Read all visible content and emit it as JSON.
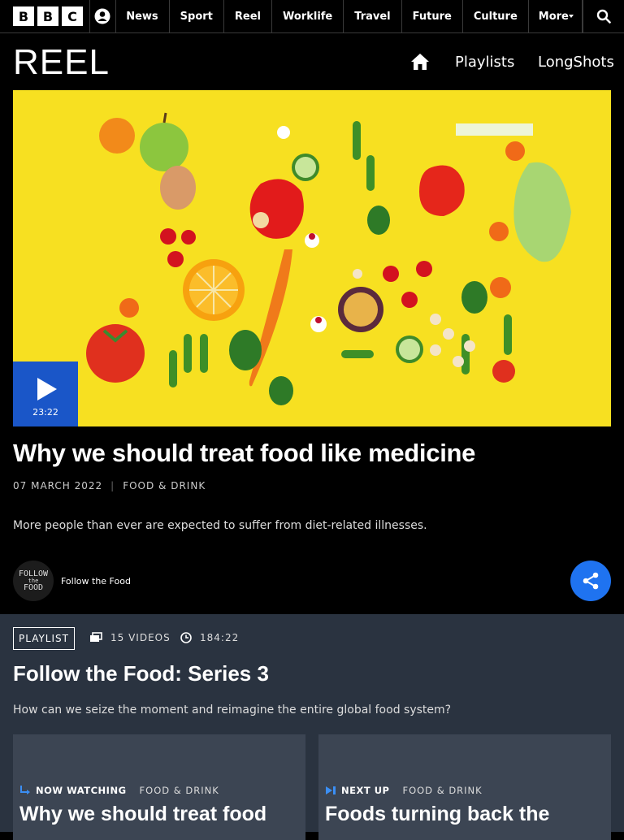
{
  "topnav": {
    "logo_letters": [
      "B",
      "B",
      "C"
    ],
    "links": [
      "News",
      "Sport",
      "Reel",
      "Worklife",
      "Travel",
      "Future",
      "Culture"
    ],
    "more_label": "More"
  },
  "reel_header": {
    "logo": "REEL",
    "links": [
      "Playlists",
      "LongShots"
    ]
  },
  "video": {
    "duration": "23:22",
    "title": "Why we should treat food like medicine",
    "date": "07 MARCH 2022",
    "separator": "|",
    "category": "FOOD & DRINK",
    "description": "More people than ever are expected to suffer from diet-related illnesses.",
    "brand_avatar_lines": [
      "FOLLOW",
      "the",
      "FOOD"
    ],
    "brand_name": "Follow the Food"
  },
  "playlist": {
    "tag": "PLAYLIST",
    "video_count": "15 VIDEOS",
    "duration": "184:22",
    "title": "Follow the Food: Series 3",
    "description": "How can we seize the moment and reimagine the entire global food system?",
    "cards": [
      {
        "kind": "NOW WATCHING",
        "category": "FOOD & DRINK",
        "title": "Why we should treat food"
      },
      {
        "kind": "NEXT UP",
        "category": "FOOD & DRINK",
        "title": "Foods turning back the"
      }
    ]
  },
  "colors": {
    "accent_blue": "#1f73f0",
    "hero_yellow": "#f7e021",
    "playlist_bg": "#2a3340"
  }
}
